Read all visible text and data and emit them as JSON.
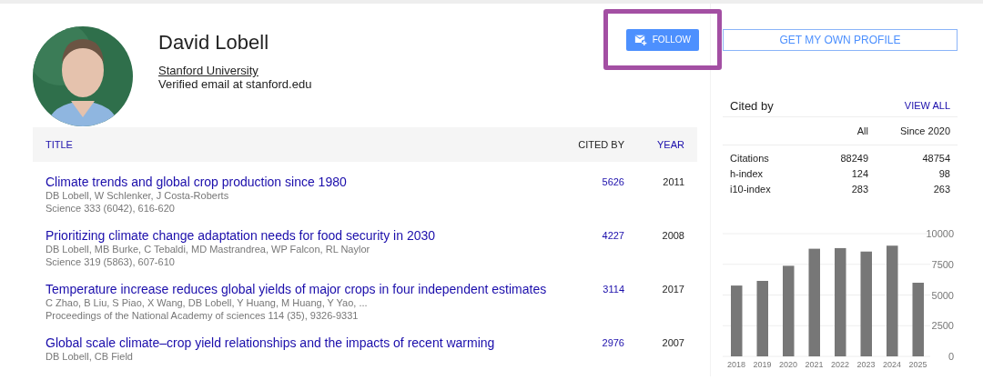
{
  "profile": {
    "name": "David Lobell",
    "affiliation": "Stanford University",
    "email": "Verified email at stanford.edu"
  },
  "follow_button": {
    "label": "FOLLOW",
    "highlighted": true
  },
  "get_profile_button": {
    "label": "GET MY OWN PROFILE"
  },
  "articles": {
    "columns": [
      "TITLE",
      "CITED BY",
      "YEAR"
    ],
    "rows": [
      {
        "title": "Climate trends and global crop production since 1980",
        "authors": "DB Lobell, W Schlenker, J Costa-Roberts",
        "venue": "Science 333 (6042), 616-620",
        "cited_by": "5626",
        "year": "2011"
      },
      {
        "title": "Prioritizing climate change adaptation needs for food security in 2030",
        "authors": "DB Lobell, MB Burke, C Tebaldi, MD Mastrandrea, WP Falcon, RL Naylor",
        "venue": "Science 319 (5863), 607-610",
        "cited_by": "4227",
        "year": "2008"
      },
      {
        "title": "Temperature increase reduces global yields of major crops in four independent estimates",
        "authors": "C Zhao, B Liu, S Piao, X Wang, DB Lobell, Y Huang, M Huang, Y Yao, ...",
        "venue": "Proceedings of the National Academy of sciences 114 (35), 9326-9331",
        "cited_by": "3114",
        "year": "2017"
      },
      {
        "title": "Global scale climate–crop yield relationships and the impacts of recent warming",
        "authors": "DB Lobell, CB Field",
        "cited_by": "2976",
        "year": "2007"
      }
    ]
  },
  "cited_by": {
    "title": "Cited by",
    "view_all": "VIEW ALL",
    "columns": [
      "All",
      "Since 2020"
    ],
    "rows": [
      {
        "label": "Citations",
        "all": "88249",
        "since": "48754"
      },
      {
        "label": "h-index",
        "all": "124",
        "since": "98"
      },
      {
        "label": "i10-index",
        "all": "283",
        "since": "263"
      }
    ],
    "chart_data": {
      "type": "bar",
      "categories": [
        "2018",
        "2019",
        "2020",
        "2021",
        "2022",
        "2023",
        "2024",
        "2025"
      ],
      "values": [
        5770,
        6150,
        7380,
        8770,
        8820,
        8540,
        9020,
        6000
      ],
      "ylim": [
        0,
        10000
      ],
      "grid": true,
      "yticks": [
        0,
        2500,
        5000,
        7500,
        10000
      ]
    }
  }
}
